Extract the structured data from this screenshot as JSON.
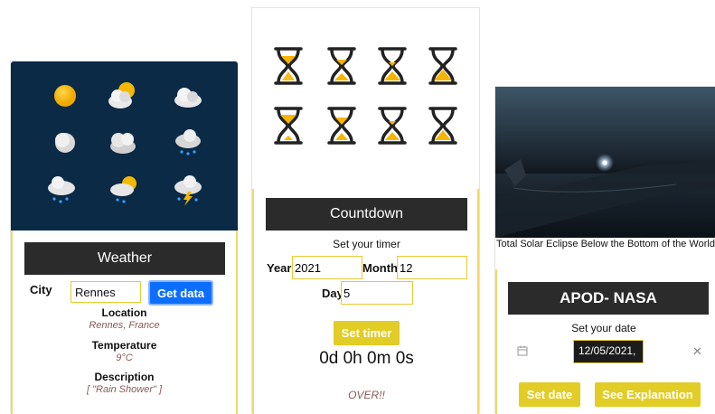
{
  "weather": {
    "title": "Weather",
    "city_label": "City",
    "city_value": "Rennes",
    "button": "Get data",
    "location_label": "Location",
    "location_value": "Rennes, France",
    "temperature_label": "Temperature",
    "temperature_value": "9°C",
    "description_label": "Description",
    "description_value": "[ \"Rain Shower\" ]",
    "icons": [
      "sun-icon",
      "partly-cloudy-icon",
      "cloud-icon",
      "moon-icon",
      "cloudy-night-icon",
      "rain-night-icon",
      "rain-icon",
      "sun-rain-icon",
      "thunderstorm-icon"
    ]
  },
  "countdown": {
    "title": "Countdown",
    "subtitle": "Set your timer",
    "year_label": "Year",
    "year_value": "2021",
    "month_label": "Month",
    "month_value": "12",
    "day_label": "Day",
    "day_value": "5",
    "button": "Set timer",
    "time_left": "0d 0h 0m 0s",
    "status": "OVER!!"
  },
  "apod": {
    "caption": "Total Solar Eclipse Below the Bottom of the World",
    "title": "APOD- NASA",
    "subtitle": "Set your date",
    "date_value": "12/05/2021,",
    "set_date_button": "Set date",
    "explanation_button": "See Explanation"
  },
  "colors": {
    "accent_yellow": "#e2cc26",
    "primary_blue": "#0d6efd",
    "dark_bar": "#2b2b2b",
    "weather_bg": "#0a2a45"
  }
}
